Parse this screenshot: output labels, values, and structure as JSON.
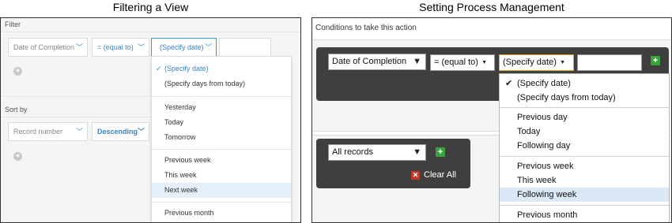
{
  "left_panel": {
    "title": "Filtering a View",
    "filter_label": "Filter",
    "field": "Date of Completion",
    "operator": "= (equal to)",
    "value": "(Specify date)",
    "sort_label": "Sort by",
    "sort_field": "Record number",
    "sort_order": "Descending",
    "add_icon": "plus-circle-icon",
    "dropdown": [
      {
        "label": "(Specify date)",
        "selected": true
      },
      {
        "label": "(Specify days from today)"
      },
      {
        "label": "Yesterday"
      },
      {
        "label": "Today"
      },
      {
        "label": "Tomorrow"
      },
      {
        "label": "Previous week"
      },
      {
        "label": "This week"
      },
      {
        "label": "Next week",
        "highlighted": true
      },
      {
        "label": "Previous month"
      }
    ],
    "accent_color": "#3b83c5"
  },
  "right_panel": {
    "title": "Setting Process Management",
    "conditions_label": "Conditions to take this action",
    "field": "Date of Completion",
    "operator": "= (equal to)",
    "value": "(Specify date)",
    "records_select": "All records",
    "clear_all": "Clear All",
    "add_icon": "plus-icon",
    "clear_icon": "x-icon",
    "dropdown": [
      {
        "label": "(Specify date)",
        "selected": true
      },
      {
        "label": "(Specify days from today)"
      },
      {
        "label": "Previous day"
      },
      {
        "label": "Today"
      },
      {
        "label": "Following day"
      },
      {
        "label": "Previous week"
      },
      {
        "label": "This week"
      },
      {
        "label": "Following week",
        "highlighted": true
      },
      {
        "label": "Previous month"
      }
    ],
    "accent_color": "#e8a317",
    "add_color": "#3aa23a",
    "clear_color": "#c0392b"
  }
}
